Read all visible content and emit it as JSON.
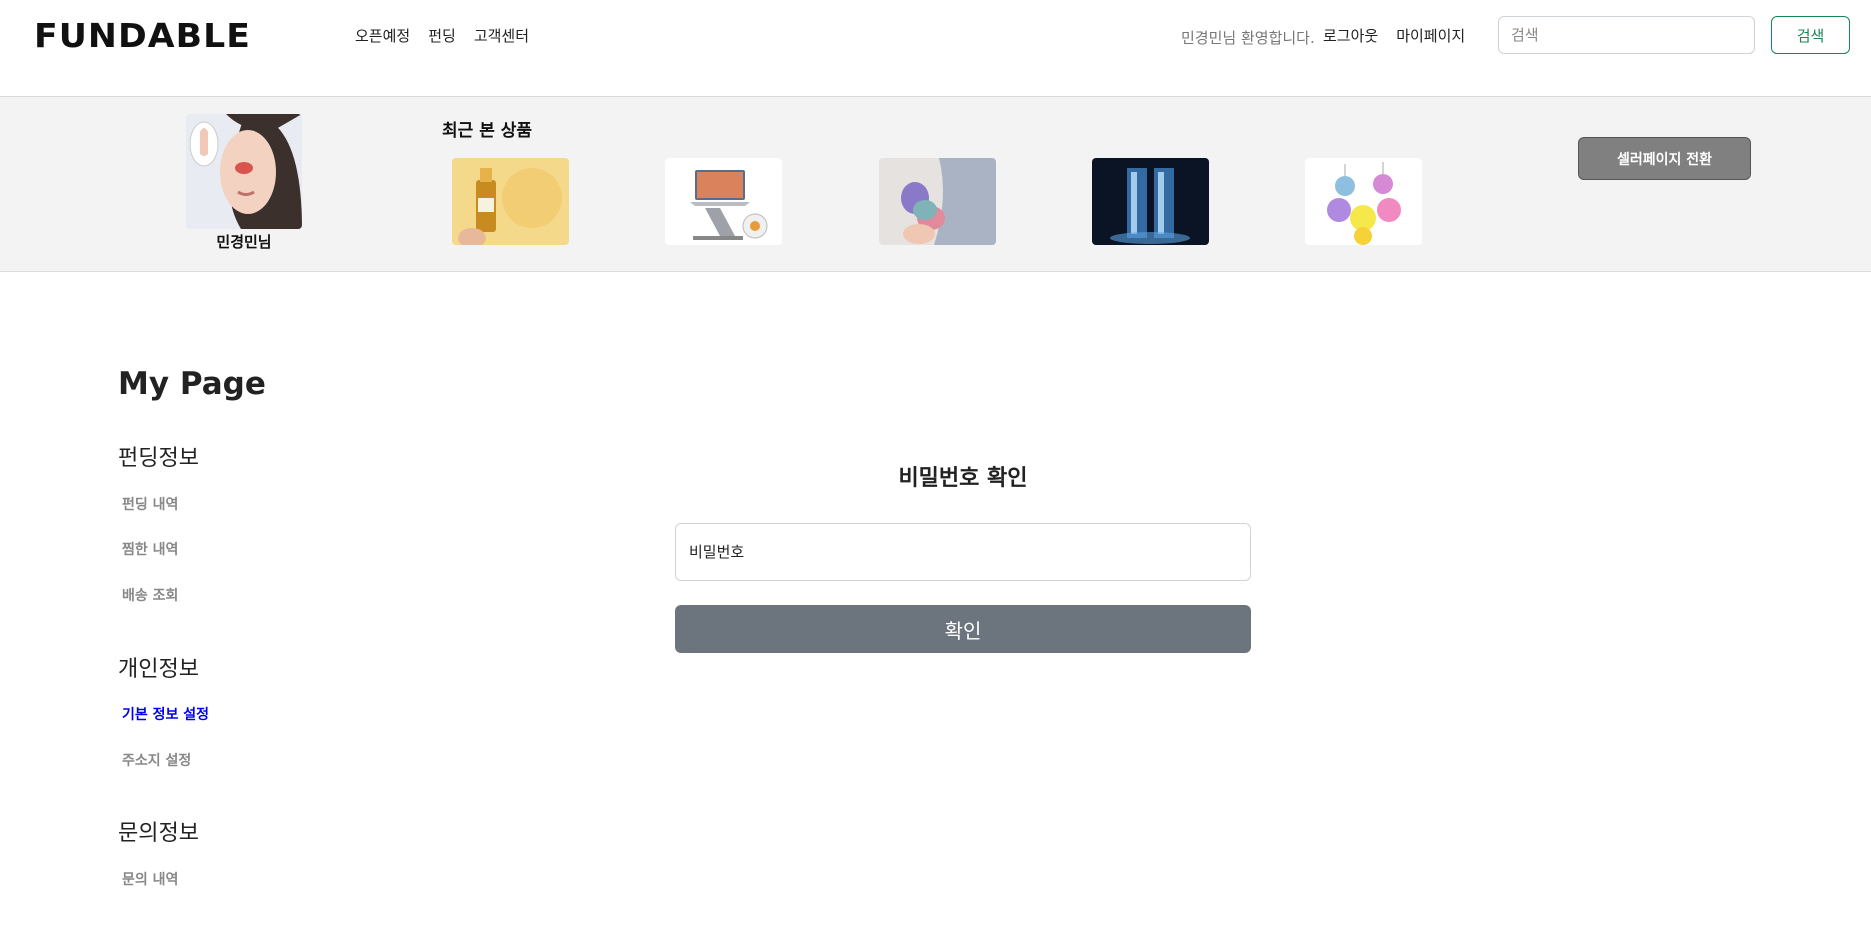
{
  "header": {
    "logo": "FUNDABLE",
    "nav": [
      "오픈예정",
      "펀딩",
      "고객센터"
    ],
    "welcome": "민경민님 환영합니다.",
    "logout": "로그아웃",
    "mypage": "마이페이지",
    "search_placeholder": "검색",
    "search_button": "검색"
  },
  "recent": {
    "profile_name": "민경민님",
    "title": "최근 본 상품",
    "seller_button": "셀러페이지 전환",
    "thumbnails": [
      "serum-product",
      "laptop-stand-product",
      "sponge-product",
      "ice-glass-product",
      "gummy-bear-product"
    ]
  },
  "sidebar": {
    "page_title": "My Page",
    "sections": [
      {
        "title": "펀딩정보",
        "items": [
          "펀딩 내역",
          "찜한 내역",
          "배송 조회"
        ]
      },
      {
        "title": "개인정보",
        "items": [
          "기본 정보 설정",
          "주소지 설정"
        ]
      },
      {
        "title": "문의정보",
        "items": [
          "문의 내역"
        ]
      }
    ],
    "active_item": "기본 정보 설정"
  },
  "password_form": {
    "title": "비밀번호 확인",
    "placeholder": "비밀번호",
    "confirm_button": "확인"
  },
  "colors": {
    "accent_green": "#198754",
    "active_link": "#0000ee",
    "confirm_button_bg": "#6c757d",
    "seller_button_bg": "#808080"
  }
}
